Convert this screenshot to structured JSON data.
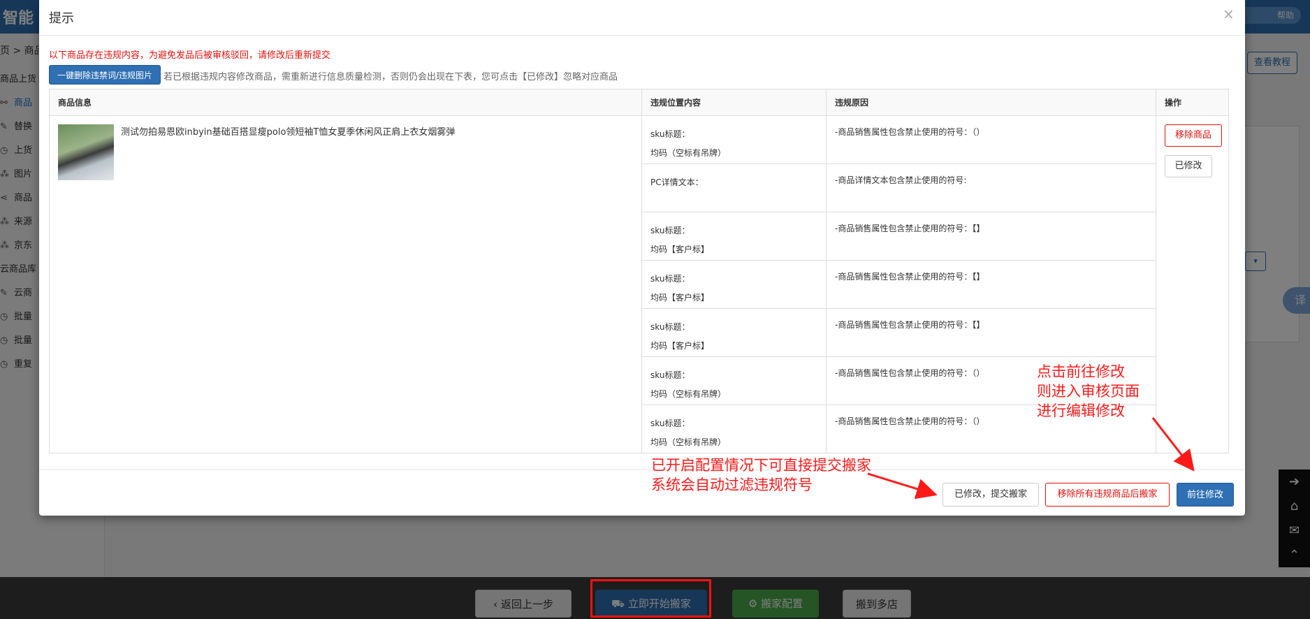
{
  "background": {
    "logo_text": "智能",
    "top_button": "帮助",
    "breadcrumb": "页 > 商品",
    "sidebar_items": [
      {
        "label": "商品上货",
        "active": false
      },
      {
        "label": "商品",
        "active": true
      },
      {
        "label": "替换",
        "active": false
      },
      {
        "label": "上货",
        "active": false
      },
      {
        "label": "图片",
        "active": false
      },
      {
        "label": "商品",
        "active": false
      },
      {
        "label": "来源",
        "active": false
      },
      {
        "label": "京东",
        "active": false
      },
      {
        "label": "云商品库",
        "active": false
      },
      {
        "label": "云商",
        "active": false
      },
      {
        "label": "批量",
        "active": false
      },
      {
        "label": "批量",
        "active": false
      },
      {
        "label": "重复",
        "active": false
      }
    ],
    "right_button": "查看教程",
    "translate_label": "译",
    "footer_buttons": {
      "back": "返回上一步",
      "start": "立即开始搬家",
      "config": "搬家配置",
      "multi": "搬到多店"
    }
  },
  "modal": {
    "title": "提示",
    "close_symbol": "×",
    "warning": "以下商品存在违规内容，为避免发品后被审核驳回，请修改后重新提交",
    "delete_button": "一键删除违禁词/违规图片",
    "hint": "若已根据违规内容修改商品，需重新进行信息质量检测，否则仍会出现在下表，您可点击【已修改】忽略对应商品",
    "table": {
      "headers": [
        "商品信息",
        "违规位置内容",
        "违规原因",
        "操作"
      ],
      "product_title": "测试勿拍易恩欧inbyin基础百搭显瘦polo领短袖T恤女夏季休闲风正肩上衣女烟雾弹",
      "rows": [
        {
          "pos_label": "sku标题：",
          "pos_value": "均码（空标有吊牌）",
          "reason": "-商品销售属性包含禁止使用的符号：（）"
        },
        {
          "pos_label": "PC详情文本：",
          "pos_value": "",
          "reason": "-商品详情文本包含禁止使用的符号:"
        },
        {
          "pos_label": "sku标题：",
          "pos_value": "均码【客户标】",
          "reason": "-商品销售属性包含禁止使用的符号：【】"
        },
        {
          "pos_label": "sku标题：",
          "pos_value": "均码【客户标】",
          "reason": "-商品销售属性包含禁止使用的符号：【】"
        },
        {
          "pos_label": "sku标题：",
          "pos_value": "均码【客户标】",
          "reason": "-商品销售属性包含禁止使用的符号：【】"
        },
        {
          "pos_label": "sku标题：",
          "pos_value": "均码（空标有吊牌）",
          "reason": "-商品销售属性包含禁止使用的符号：（）"
        },
        {
          "pos_label": "sku标题：",
          "pos_value": "均码（空标有吊牌）",
          "reason": "-商品销售属性包含禁止使用的符号：（）"
        }
      ],
      "remove_button": "移除商品",
      "modified_button": "已修改"
    },
    "footer": {
      "submit_button": "已修改，提交搬家",
      "remove_all_button": "移除所有违规商品后搬家",
      "goto_button": "前往修改"
    }
  },
  "annotations": {
    "right_note": [
      "点击前往修改",
      "则进入审核页面",
      "进行编辑修改"
    ],
    "left_note": [
      "已开启配置情况下可直接提交搬家",
      "系统会自动过滤违规符号"
    ],
    "color": "#ff1a1a"
  }
}
